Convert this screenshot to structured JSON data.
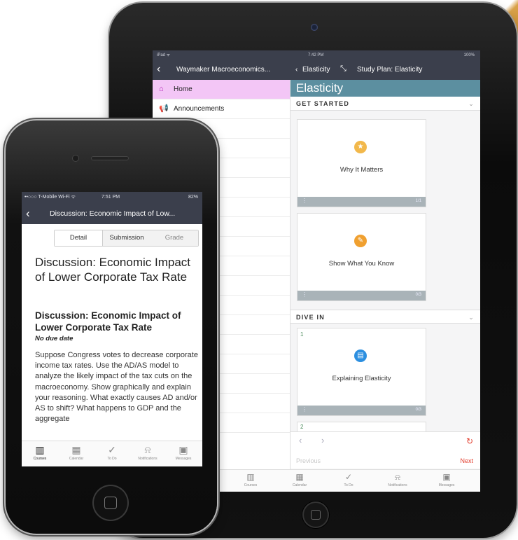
{
  "ipad": {
    "status": {
      "carrier": "iPad ᯤ",
      "time": "7:42 PM",
      "battery": "100%"
    },
    "nav": {
      "back_icon": "chevron-left",
      "left_title": "Waymaker Macroeconomics...",
      "back_label": "Elasticity",
      "right_title": "Study Plan: Elasticity"
    },
    "sidebar": {
      "items": [
        {
          "label": "Home",
          "icon": "home-icon",
          "active": true
        },
        {
          "label": "Announcements",
          "icon": "megaphone-icon",
          "active": false
        }
      ]
    },
    "main": {
      "banner": "Elasticity",
      "sections": [
        {
          "title": "GET STARTED"
        },
        {
          "title": "DIVE IN"
        }
      ],
      "cards": [
        {
          "label": "Why It Matters",
          "icon": "star-icon",
          "color": "#f2b84b",
          "progress": "1/1"
        },
        {
          "label": "Show What You Know",
          "icon": "pencil-icon",
          "color": "#f0a030",
          "progress": "0/3"
        },
        {
          "number": "1",
          "label": "Explaining Elasticity",
          "icon": "book-icon",
          "color": "#2c8fe0",
          "progress": "0/3"
        },
        {
          "number": "2"
        }
      ],
      "pager": {
        "previous": "Previous",
        "next": "Next"
      }
    },
    "tabbar": [
      "Courses",
      "Calendar",
      "To Do",
      "Notifications",
      "Messages"
    ]
  },
  "iphone": {
    "status": {
      "carrier": "••○○○ T-Mobile Wi-Fi ᯤ",
      "time": "7:51 PM",
      "battery": "82%"
    },
    "nav": {
      "title": "Discussion: Economic Impact of Low..."
    },
    "tabs": [
      "Detail",
      "Submission",
      "Grade"
    ],
    "heading": "Discussion: Economic Impact of Lower Corporate Tax Rate",
    "subheading": "Discussion: Economic Impact of Lower Corporate Tax Rate",
    "due": "No due date",
    "body": "Suppose Congress votes to decrease corporate income tax rates. Use the AD/AS model to analyze the likely impact of the tax cuts on the macroeconomy. Show graphically and explain your reasoning. What exactly causes AD and/or AS to shift? What happens to GDP and the aggregate",
    "tabbar": [
      "Courses",
      "Calendar",
      "To Do",
      "Notifications",
      "Messages"
    ]
  },
  "colors": {
    "nav_bg": "#3b3f4c",
    "banner": "#5c8fa0",
    "sidebar_active": "#f3c6f6",
    "accent_red": "#e23b2b"
  }
}
